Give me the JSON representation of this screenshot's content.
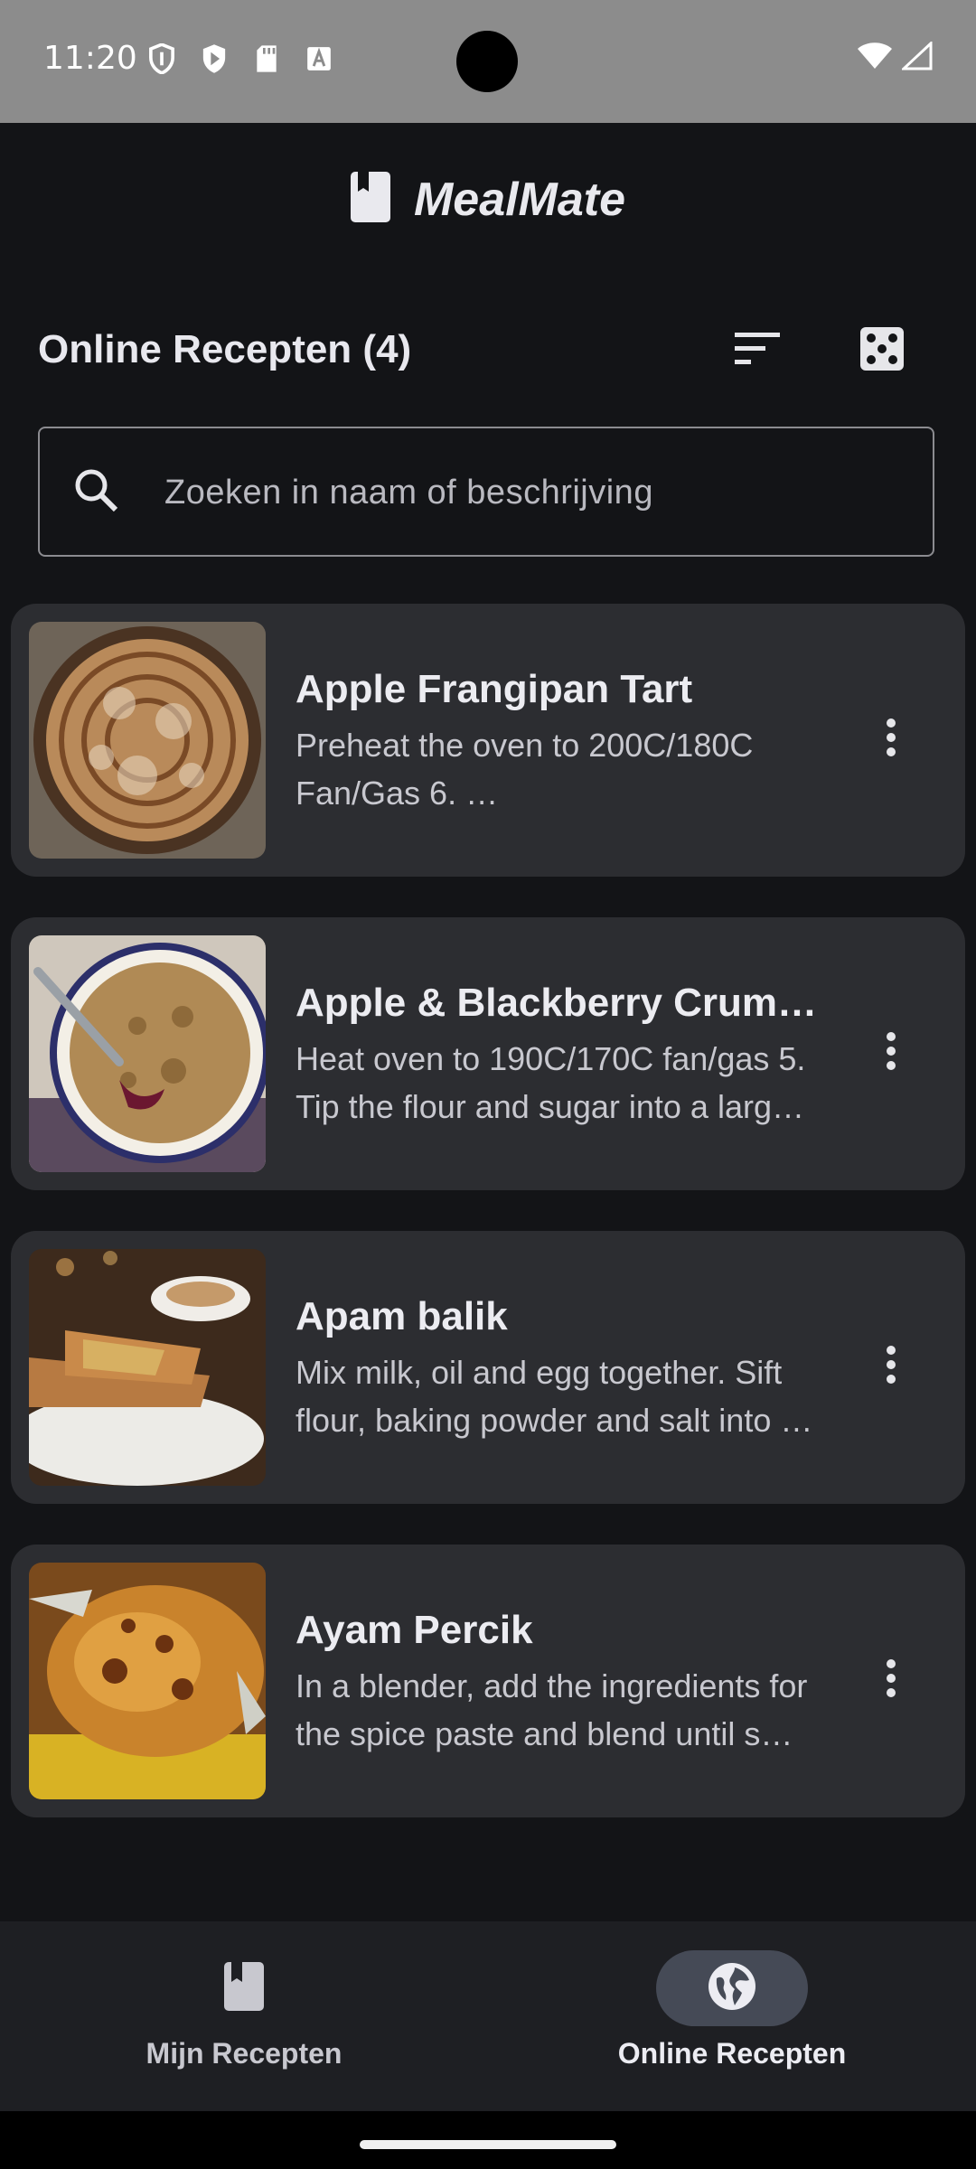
{
  "status_bar": {
    "time": "11:20"
  },
  "app": {
    "title": "MealMate"
  },
  "header": {
    "title": "Online Recepten (4)"
  },
  "search": {
    "placeholder": "Zoeken in naam of beschrijving",
    "value": ""
  },
  "recipes": [
    {
      "title": "Apple Frangipan Tart",
      "description": "Preheat the oven to 200C/180C Fan/Gas 6. …"
    },
    {
      "title": "Apple & Blackberry Crum…",
      "description": "Heat oven to 190C/170C fan/gas 5. Tip the flour and sugar into a larg…"
    },
    {
      "title": "Apam balik",
      "description": "Mix milk, oil and egg together. Sift flour, baking powder and salt into …"
    },
    {
      "title": "Ayam Percik",
      "description": "In a blender, add the ingredients for the spice paste and blend until s…"
    }
  ],
  "bottom_nav": {
    "items": [
      {
        "label": "Mijn Recepten",
        "icon": "book-icon",
        "active": false
      },
      {
        "label": "Online Recepten",
        "icon": "globe-icon",
        "active": true
      }
    ]
  },
  "colors": {
    "background": "#131417",
    "card": "#2c2d31",
    "nav_active_pill": "#454a56",
    "status_bar": "#8c8c8c"
  }
}
